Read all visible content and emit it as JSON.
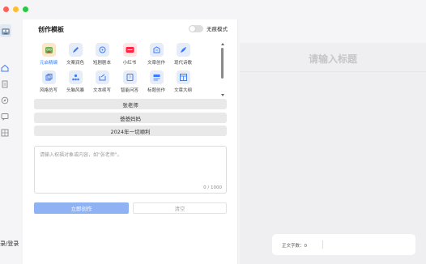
{
  "colors": {
    "accent": "#3a7afe",
    "primary_button": "#8fb2f4",
    "panel_bg": "#ffffff",
    "editor_bg": "#efeff1"
  },
  "sidebar": {
    "icons": [
      "home-icon",
      "document-icon",
      "compass-icon",
      "chat-icon",
      "template-icon"
    ],
    "login_label": "录/登录"
  },
  "panel": {
    "title": "创作模板",
    "mode_label": "无痕模式",
    "mode_enabled": false,
    "templates": [
      {
        "label": "元启精编",
        "icon": "monster-icon",
        "active": true
      },
      {
        "label": "文案润色",
        "icon": "pen-icon",
        "active": false
      },
      {
        "label": "短剧剧本",
        "icon": "film-icon",
        "active": false
      },
      {
        "label": "小红书",
        "icon": "xiaohongshu-icon",
        "active": false
      },
      {
        "label": "文章创作",
        "icon": "article-icon",
        "active": false
      },
      {
        "label": "现代诗歌",
        "icon": "poem-icon",
        "active": false
      },
      {
        "label": "风格仿写",
        "icon": "copy-icon",
        "active": false
      },
      {
        "label": "头脑风暴",
        "icon": "brainstorm-icon",
        "active": false
      },
      {
        "label": "文本续写",
        "icon": "continue-icon",
        "active": false
      },
      {
        "label": "智能问答",
        "icon": "qa-icon",
        "active": false
      },
      {
        "label": "标题创作",
        "icon": "title-icon",
        "active": false
      },
      {
        "label": "文章大纲",
        "icon": "outline-icon",
        "active": false
      }
    ],
    "suggestions": [
      "张老师",
      "爸爸妈妈",
      "2024年一切顺利"
    ],
    "textarea_placeholder": "请输入祝福对象或内容，如\"张老师\"。",
    "counter": "0 / 1000",
    "generate_label": "立即创作",
    "clear_label": "清空"
  },
  "editor": {
    "title_placeholder": "请输入标题",
    "word_count_label": "正文字数：",
    "word_count": "0"
  }
}
